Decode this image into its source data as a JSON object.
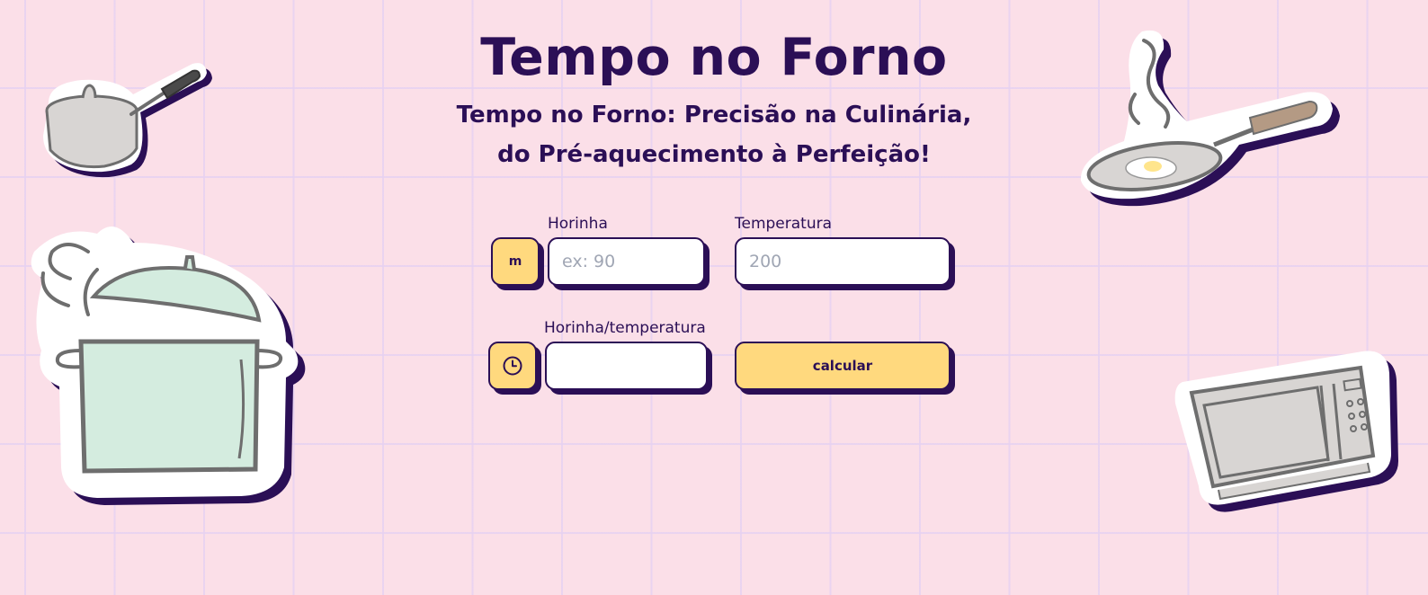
{
  "header": {
    "title": "Tempo no Forno",
    "subtitle_line1": "Tempo no Forno: Precisão na Culinária,",
    "subtitle_line2": "do Pré-aquecimento à Perfeição!"
  },
  "form": {
    "unit_toggle_label": "m",
    "time_label": "Horinha",
    "time_placeholder": "ex: 90",
    "temperature_label": "Temperatura",
    "temperature_placeholder": "200",
    "result_label": "Horinha/temperatura",
    "result_value": "",
    "calculate_label": "calcular"
  },
  "icons": {
    "timer": "clock-icon",
    "decor": [
      "saucepan-icon",
      "stock-pot-icon",
      "frying-pan-icon",
      "microwave-icon"
    ]
  },
  "colors": {
    "background": "#fbdfe8",
    "ink": "#2b0f56",
    "accent": "#ffd97e"
  }
}
